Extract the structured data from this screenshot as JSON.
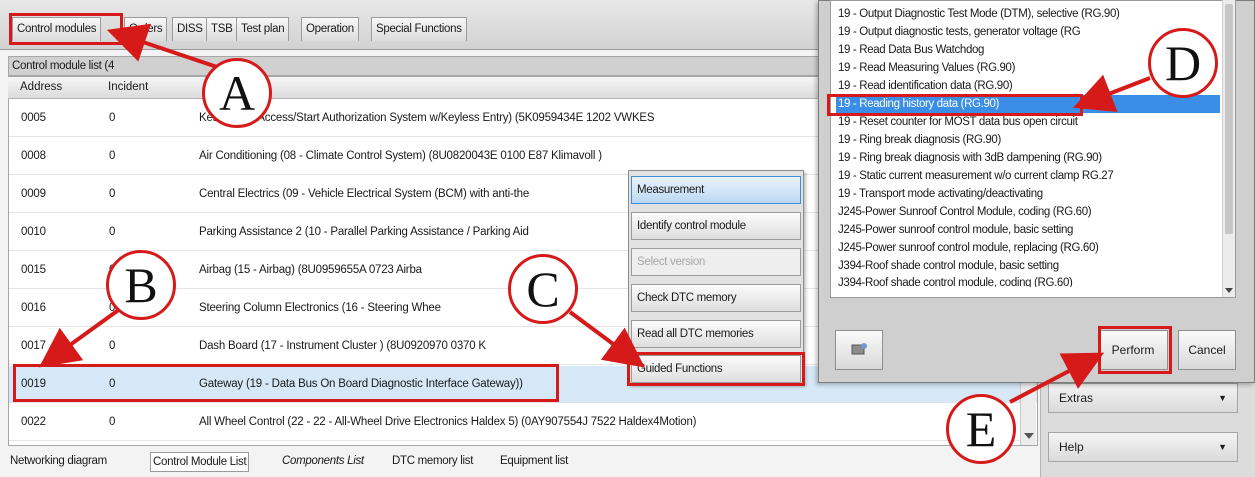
{
  "top_tabs": [
    "Control modules",
    "Orders",
    "DISS",
    "TSB",
    "Test plan",
    "Operation",
    "Special Functions"
  ],
  "list_title": "Control module list (4",
  "columns": {
    "address": "Address",
    "incident": "Incident"
  },
  "rows": [
    {
      "address": "0005",
      "incident": "0",
      "desc": "Kessy (05 - Access/Start Authorization System w/Keyless Entry) (5K0959434E    1202  VWKES"
    },
    {
      "address": "0008",
      "incident": "0",
      "desc": "Air Conditioning (08 - Climate Control System) (8U0820043E    0100  E87  Klimavoll    )"
    },
    {
      "address": "0009",
      "incident": "0",
      "desc": "Central Electrics (09 - Vehicle Electrical System (BCM) with anti-the"
    },
    {
      "address": "0010",
      "incident": "0",
      "desc": "Parking Assistance 2 (10 - Parallel Parking Assistance / Parking Aid"
    },
    {
      "address": "0015",
      "incident": "0",
      "desc": "Airbag (15 - Airbag) (8U0959655A    0723  Airba"
    },
    {
      "address": "0016",
      "incident": "0",
      "desc": "Steering Column Electronics (16 - Steering Whee"
    },
    {
      "address": "0017",
      "incident": "0",
      "desc": "Dash Board (17 - Instrument Cluster  ) (8U0920970    0370  K"
    },
    {
      "address": "0019",
      "incident": "0",
      "desc": "Gateway (19 - Data Bus On Board Diagnostic Interface  Gateway))"
    },
    {
      "address": "0022",
      "incident": "0",
      "desc": "All Wheel Control (22 - 22 - All-Wheel Drive Electronics Haldex 5) (0AY907554J    7522  Haldex4Motion)"
    }
  ],
  "context_menu": [
    "Measurement",
    "Identify control module",
    "Select version",
    "Check DTC memory",
    "Read all DTC memories",
    "Guided Functions"
  ],
  "functions": [
    "19 - Output Diagnostic Test Mode (DTM), selective (RG.90)",
    "19 - Output diagnostic tests, generator voltage (RG",
    "19 - Read Data Bus Watchdog",
    "19 - Read Measuring Values (RG.90)",
    "19 - Read identification data (RG.90)",
    "19 - Reading history data (RG.90)",
    "19 - Reset counter for MOST data bus open circuit",
    "19 - Ring break diagnosis (RG.90)",
    "19 - Ring break diagnosis with 3dB dampening (RG.90)",
    "19 - Static current measurement w/o current clamp RG.27",
    "19 - Transport mode activating/deactivating",
    "J245-Power Sunroof Control Module, coding (RG.60)",
    "J245-Power sunroof control module, basic setting",
    "J245-Power sunroof control module, replacing (RG.60)",
    "J394-Roof shade control module, basic setting",
    "J394-Roof shade control module, coding (RG.60)"
  ],
  "dialog_buttons": {
    "perform": "Perform",
    "cancel": "Cancel"
  },
  "bottom_tabs": [
    "Networking diagram",
    "Control Module List",
    "Components List",
    "DTC memory list",
    "Equipment list"
  ],
  "right_panel": {
    "extras": "Extras",
    "help": "Help"
  },
  "callouts": [
    "A",
    "B",
    "C",
    "D",
    "E"
  ],
  "colors": {
    "annotation_red": "#d61a1a",
    "selection_blue": "#3a8ee6",
    "row_highlight": "#d6e8f7"
  }
}
